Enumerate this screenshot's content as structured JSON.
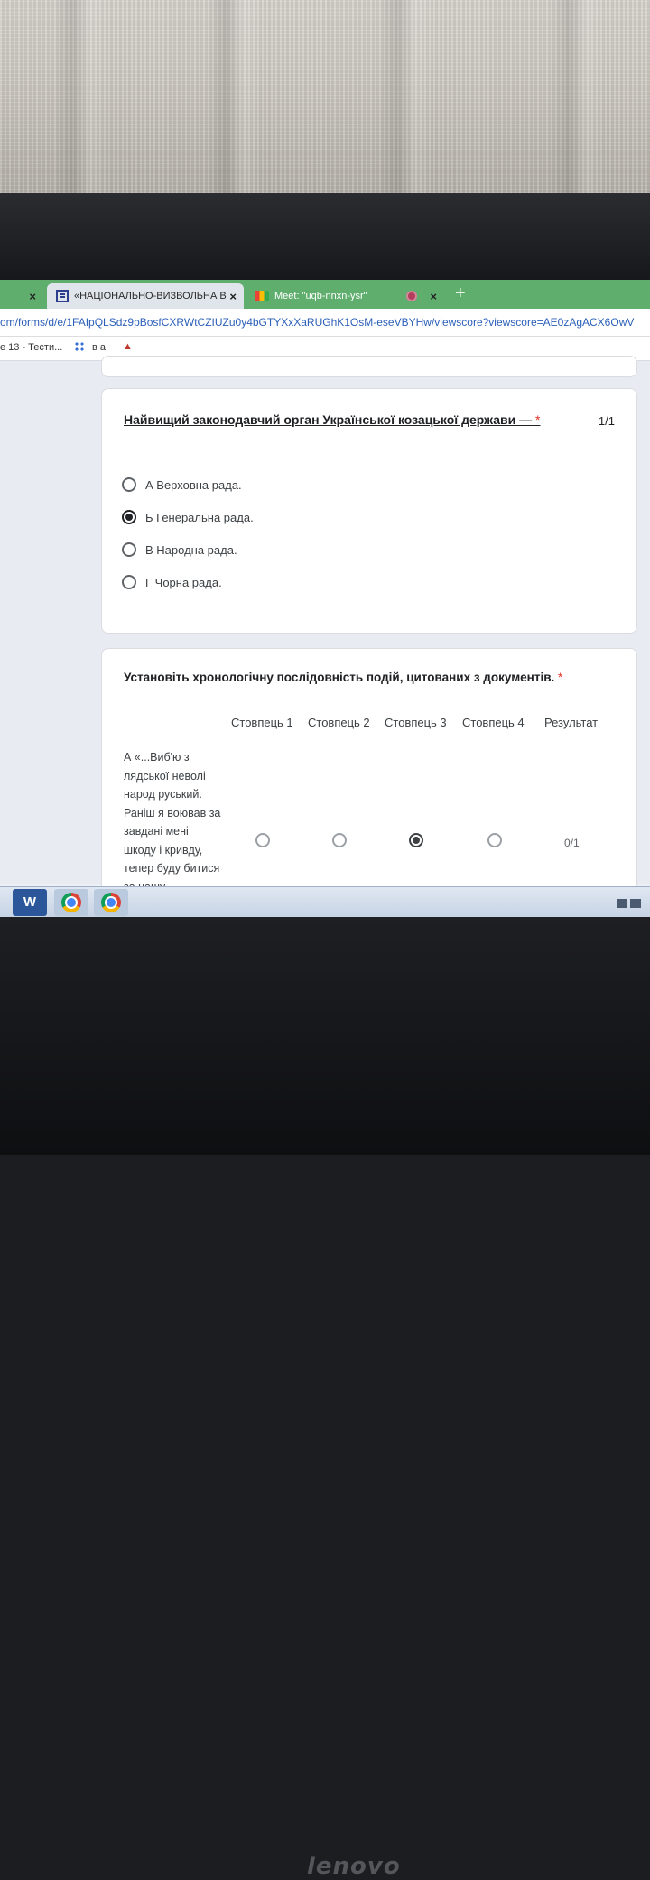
{
  "browser": {
    "tabs": [
      {
        "label": "",
        "close": "×"
      },
      {
        "label": "«НАЦІОНАЛЬНО-ВИЗВОЛЬНА В",
        "close": "×"
      },
      {
        "label": "Meet: \"uqb-nnxn-ysr\"",
        "close": "×"
      }
    ],
    "new_tab": "+",
    "address": "om/forms/d/e/1FAIpQLSdz9pBosfCXRWtCZIUZu0y4bGTYXxXaRUGhK1OsM-eseVBYHw/viewscore?viewscore=AE0zAgACX6OwV",
    "bookmarks": [
      "e 13 - Тести...",
      "в а"
    ]
  },
  "question1": {
    "title": "Найвищий законодавчий орган Української козацької держави —",
    "required": "*",
    "score": "1/1",
    "options": [
      {
        "label": "А Верховна рада.",
        "selected": false
      },
      {
        "label": "Б Генеральна рада.",
        "selected": true
      },
      {
        "label": "В Народна рада.",
        "selected": false
      },
      {
        "label": "Г Чорна рада.",
        "selected": false
      }
    ]
  },
  "question2": {
    "title": "Установіть хронологічну послідовність подій, цитованих з документів.",
    "required": "*",
    "columns": [
      "Стовпець 1",
      "Стовпець 2",
      "Стовпець 3",
      "Стовпець 4",
      "Результат"
    ],
    "row": {
      "text": "А «...Виб'ю з лядської неволі народ руський. Раніш я воював за завдані мені шкоду і кривду, тепер буду битися за нашу",
      "selected_column": 3,
      "score": "0/1"
    }
  },
  "taskbar": {
    "word_label": "W"
  },
  "device": {
    "brand": "lenovo"
  }
}
